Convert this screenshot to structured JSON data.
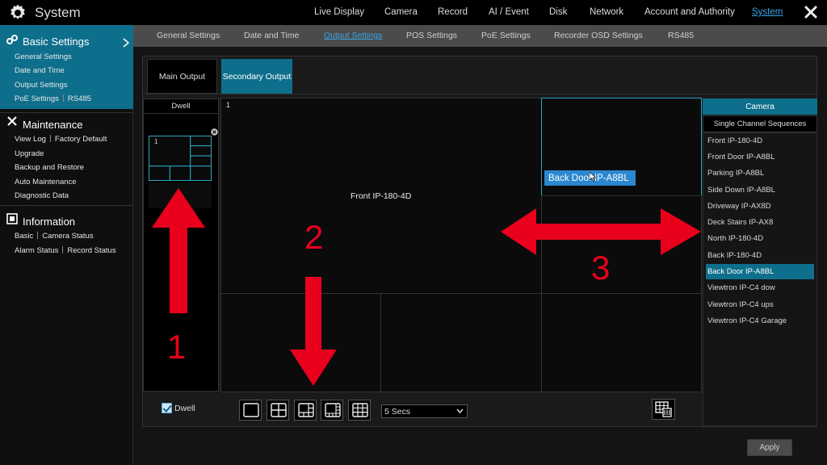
{
  "app": {
    "title": "System"
  },
  "topnav": {
    "items": [
      "Live Display",
      "Camera",
      "Record",
      "AI / Event",
      "Disk",
      "Network",
      "Account and Authority",
      "System"
    ],
    "active": "System"
  },
  "sidebar": {
    "basic_settings": {
      "title": "Basic Settings",
      "items": [
        "General Settings",
        "Date and Time",
        "Output Settings",
        "PoE Settings",
        "RS485"
      ]
    },
    "maintenance": {
      "title": "Maintenance",
      "items": [
        "View Log",
        "Factory Default",
        "Upgrade",
        "Backup and Restore",
        "Auto Maintenance",
        "Diagnostic Data"
      ]
    },
    "information": {
      "title": "Information",
      "items": [
        "Basic",
        "Camera Status",
        "Alarm Status",
        "Record Status"
      ]
    }
  },
  "subtabs": {
    "items": [
      "General Settings",
      "Date and Time",
      "Output Settings",
      "POS Settings",
      "PoE Settings",
      "Recorder OSD Settings",
      "RS485"
    ],
    "active": "Output Settings"
  },
  "output_tabs": {
    "main": "Main Output",
    "secondary": "Secondary Output",
    "active": "Secondary Output"
  },
  "dwell": {
    "header": "Dwell",
    "thumbnail_number": "1",
    "checkbox_label": "Dwell",
    "checked": true
  },
  "layout": {
    "cell_numbers": {
      "cell1": "1"
    },
    "cell_labels": {
      "cell1": "Front IP-180-4D"
    },
    "drag_label": "Back Door IP-A8BL"
  },
  "controls": {
    "dwell_time": "5 Secs"
  },
  "camera_panel": {
    "header": "Camera",
    "sequence_button": "Single Channel Sequences",
    "cameras": [
      "Front IP-180-4D",
      "Front Door IP-A8BL",
      "Parking IP-A8BL",
      "Side Down IP-A8BL",
      "Driveway IP-AX8D",
      "Deck Stairs IP-AX8",
      "North IP-180-4D",
      "Back IP-180-4D",
      "Back Door IP-A8BL",
      "Viewtron IP-C4 dow",
      "Viewtron IP-C4 ups",
      "Viewtron IP-C4 Garage"
    ],
    "selected": "Back Door IP-A8BL"
  },
  "apply_label": "Apply",
  "annotations": [
    "1",
    "2",
    "3"
  ],
  "colors": {
    "accent": "#0e6f8c",
    "link_active": "#3aa4e6",
    "annotation": "#e8001c",
    "selection": "#2ea3c2"
  }
}
